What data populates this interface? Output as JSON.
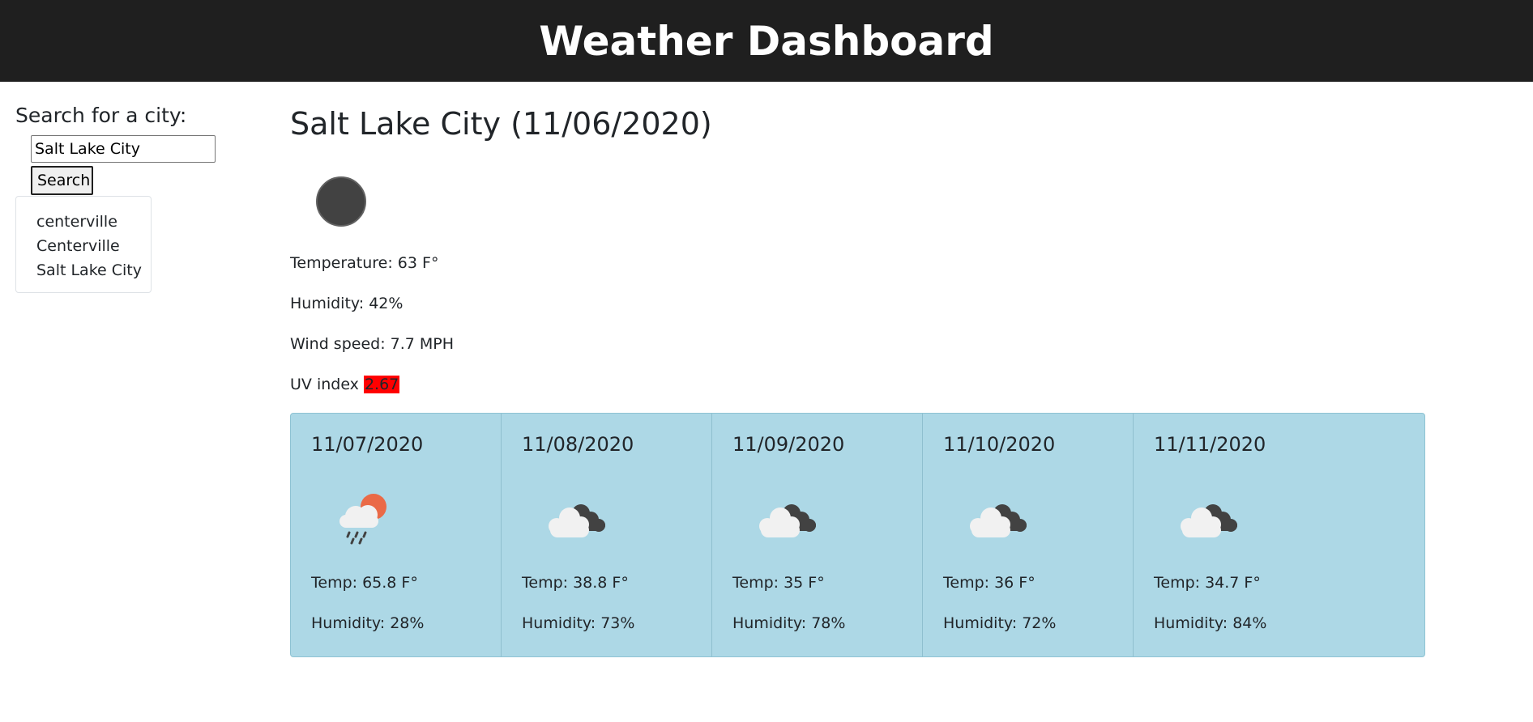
{
  "header": {
    "title": "Weather Dashboard"
  },
  "search": {
    "label": "Search for a city:",
    "value": "Salt Lake City",
    "button_label": "Search",
    "history": [
      "centerville",
      "Centerville",
      "Salt Lake City"
    ]
  },
  "current": {
    "title": "Salt Lake City (11/06/2020)",
    "icon": "dark-circle-icon",
    "temperature": "Temperature: 63 F°",
    "humidity": "Humidity: 42%",
    "wind": "Wind speed: 7.7 MPH",
    "uv_label": "UV index ",
    "uv_value": "2.67",
    "uv_color": "#ff0000"
  },
  "forecast": [
    {
      "date": "11/07/2020",
      "icon": "sun-cloud-rain-icon",
      "temp": "Temp: 65.8 F°",
      "humidity": "Humidity: 28%"
    },
    {
      "date": "11/08/2020",
      "icon": "cloudy-icon",
      "temp": "Temp: 38.8 F°",
      "humidity": "Humidity: 73%"
    },
    {
      "date": "11/09/2020",
      "icon": "cloudy-icon",
      "temp": "Temp: 35 F°",
      "humidity": "Humidity: 78%"
    },
    {
      "date": "11/10/2020",
      "icon": "cloudy-icon",
      "temp": "Temp: 36 F°",
      "humidity": "Humidity: 72%"
    },
    {
      "date": "11/11/2020",
      "icon": "cloudy-icon",
      "temp": "Temp: 34.7 F°",
      "humidity": "Humidity: 84%"
    }
  ],
  "colors": {
    "header_bg": "#1f1f1f",
    "forecast_bg": "#add8e6"
  }
}
